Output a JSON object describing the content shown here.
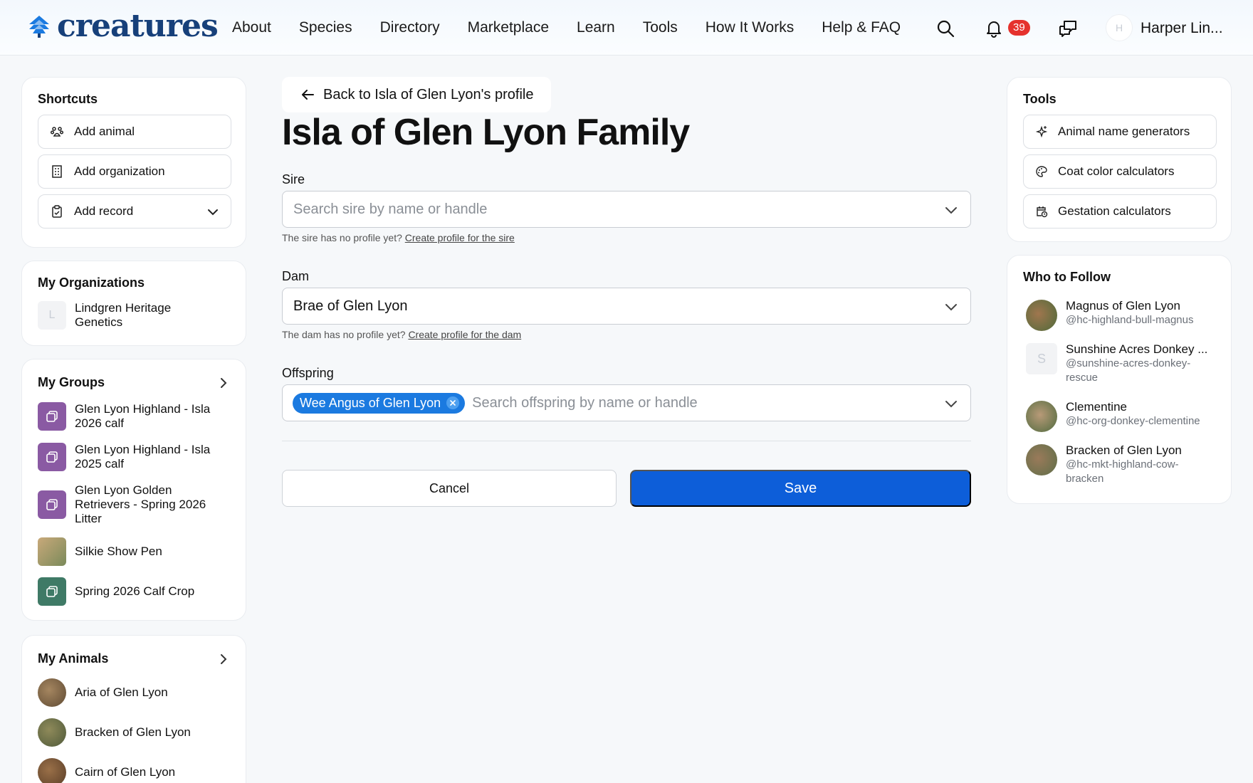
{
  "header": {
    "logo_text": "creatures",
    "nav": [
      "About",
      "Species",
      "Directory",
      "Marketplace",
      "Learn",
      "Tools",
      "How It Works",
      "Help & FAQ"
    ],
    "notification_count": "39",
    "user_initial": "H",
    "user_name": "Harper Lin..."
  },
  "shortcuts": {
    "title": "Shortcuts",
    "items": [
      {
        "label": "Add animal",
        "icon": "paw-icon"
      },
      {
        "label": "Add organization",
        "icon": "building-icon"
      },
      {
        "label": "Add record",
        "icon": "clipboard-icon"
      }
    ]
  },
  "organizations": {
    "title": "My Organizations",
    "items": [
      {
        "initial": "L",
        "line1": "Lindgren Heritage",
        "line2": "Genetics"
      }
    ]
  },
  "groups": {
    "title": "My Groups",
    "items": [
      {
        "line1": "Glen Lyon Highland - Isla",
        "line2": "2026 calf",
        "line3": "",
        "color": "#8a5aa3"
      },
      {
        "line1": "Glen Lyon Highland - Isla",
        "line2": "2025 calf",
        "line3": "",
        "color": "#8a5aa3"
      },
      {
        "line1": "Glen Lyon Golden",
        "line2": "Retrievers - Spring 2026",
        "line3": "Litter",
        "color": "#8a5aa3"
      },
      {
        "line1": "Silkie Show Pen",
        "line2": "",
        "line3": "",
        "color": "#b99a6a"
      },
      {
        "line1": "Spring 2026 Calf Crop",
        "line2": "",
        "line3": "",
        "color": "#3f7a66"
      }
    ]
  },
  "animals": {
    "title": "My Animals",
    "items": [
      {
        "name": "Aria of Glen Lyon",
        "color": "#8a6a4a"
      },
      {
        "name": "Bracken of Glen Lyon",
        "color": "#6f7a4e"
      },
      {
        "name": "Cairn of Glen Lyon",
        "color": "#7a5a3e"
      }
    ]
  },
  "main": {
    "back_label": "Back to Isla of Glen Lyon's profile",
    "title": "Isla of Glen Lyon Family",
    "sire": {
      "label": "Sire",
      "placeholder": "Search sire by name or handle",
      "hint": "The sire has no profile yet?",
      "hint_link": "Create profile for the sire"
    },
    "dam": {
      "label": "Dam",
      "value": "Brae of Glen Lyon",
      "hint": "The dam has no profile yet?",
      "hint_link": "Create profile for the dam"
    },
    "offspring": {
      "label": "Offspring",
      "chip": "Wee Angus of Glen Lyon",
      "placeholder": "Search offspring by name or handle"
    },
    "cancel_label": "Cancel",
    "save_label": "Save",
    "accent": "#0d5ed9"
  },
  "tools": {
    "title": "Tools",
    "items": [
      {
        "label": "Animal name generators",
        "icon": "sparkle-icon"
      },
      {
        "label": "Coat color calculators",
        "icon": "palette-icon"
      },
      {
        "label": "Gestation calculators",
        "icon": "calendar-clock-icon"
      }
    ]
  },
  "follow": {
    "title": "Who to Follow",
    "items": [
      {
        "name": "Magnus of Glen Lyon",
        "handle1": "@hc-highland-bull-magnus",
        "handle2": "",
        "color": "#7b5a3c"
      },
      {
        "name": "Sunshine Acres Donkey ...",
        "handle1": "@sunshine-acres-donkey-",
        "handle2": "rescue",
        "initial": "S",
        "color": "#f2f3f5"
      },
      {
        "name": "Clementine",
        "handle1": "@hc-org-donkey-clementine",
        "handle2": "",
        "color": "#6d7b5a"
      },
      {
        "name": "Bracken of Glen Lyon",
        "handle1": "@hc-mkt-highland-cow-",
        "handle2": "bracken",
        "color": "#857055"
      }
    ]
  }
}
